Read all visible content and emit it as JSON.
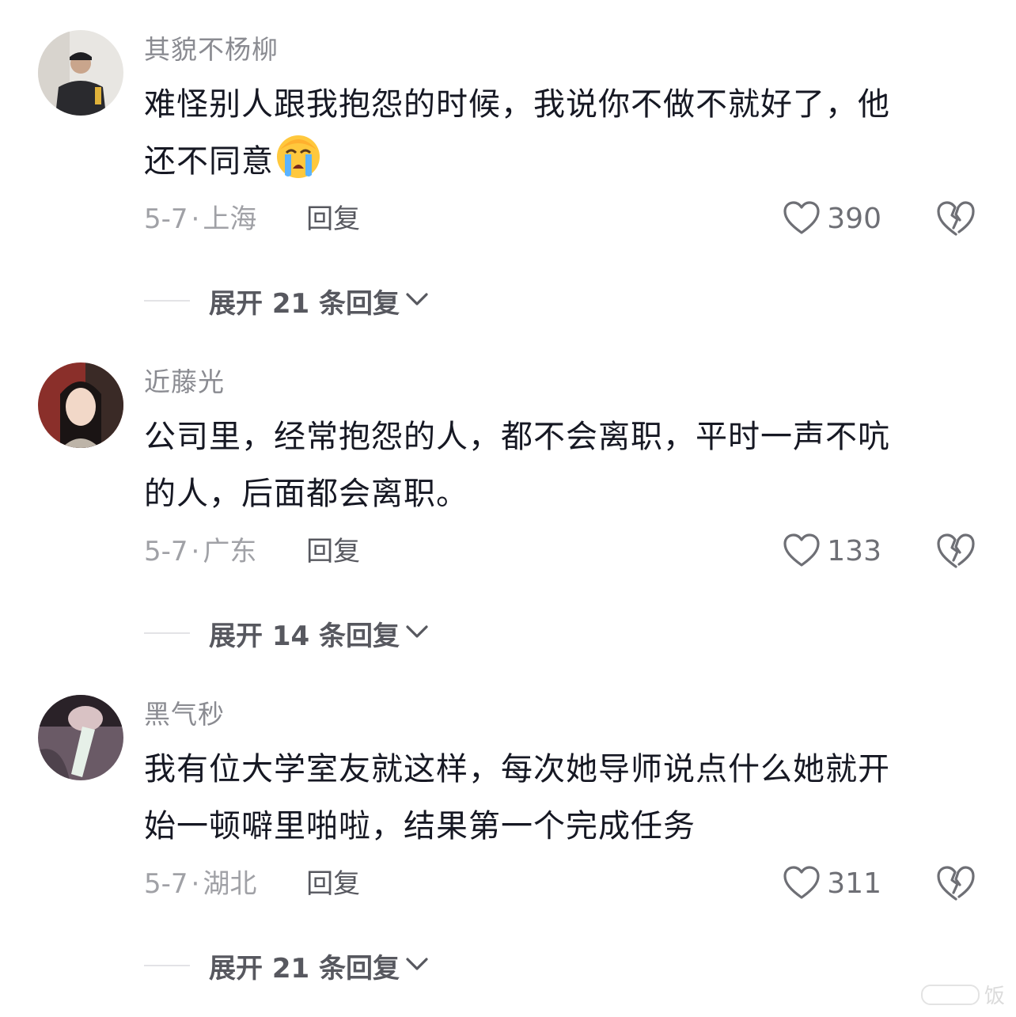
{
  "comments": [
    {
      "username": "其貌不杨柳",
      "lines": [
        "难怪别人跟我抱怨的时候，我说你不做不就好了，他",
        "还不同意"
      ],
      "has_emoji": true,
      "emoji": "loudly-crying-face",
      "date": "5-7",
      "sep": "·",
      "location": "上海",
      "reply_label": "回复",
      "likes": "390",
      "expand_label": "展开 21 条回复"
    },
    {
      "username": "近藤光",
      "lines": [
        "公司里，经常抱怨的人，都不会离职，平时一声不吭",
        "的人，后面都会离职。"
      ],
      "has_emoji": false,
      "date": "5-7",
      "sep": "·",
      "location": "广东",
      "reply_label": "回复",
      "likes": "133",
      "expand_label": "展开 14 条回复"
    },
    {
      "username": "黑气秒",
      "lines": [
        "我有位大学室友就这样，每次她导师说点什么她就开",
        "始一顿噼里啪啦，结果第一个完成任务"
      ],
      "has_emoji": false,
      "date": "5-7",
      "sep": "·",
      "location": "湖北",
      "reply_label": "回复",
      "likes": "311",
      "expand_label": "展开 21 条回复"
    }
  ],
  "watermark": {
    "text": "饭"
  },
  "colors": {
    "text": "#161823",
    "username": "#8a8b91",
    "meta": "#a0a1a6",
    "reply": "#57585f",
    "icon": "#6e6f75",
    "rule": "#e3e3e6"
  },
  "icons": {
    "like": "heart-outline-icon",
    "dislike": "broken-heart-icon",
    "expand": "chevron-down-icon"
  }
}
